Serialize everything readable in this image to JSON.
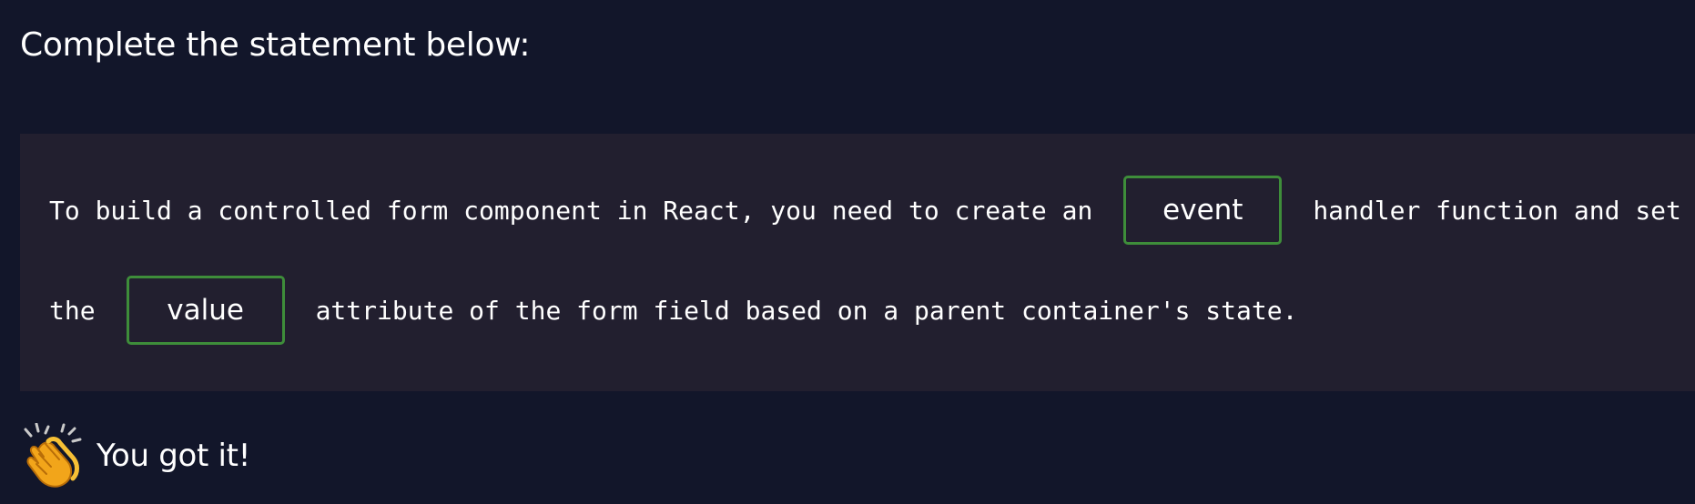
{
  "prompt": {
    "heading": "Complete the statement below:"
  },
  "statement": {
    "line1_before": "To build a controlled form component in React, you need to create an",
    "blank1_answer": "event",
    "line1_after": "handler function and set",
    "line2_before": "the",
    "blank2_answer": "value",
    "line2_after": "attribute of the form field based on a parent container's state."
  },
  "feedback": {
    "icon": "clapping-hands-icon",
    "message": "You got it!"
  },
  "colors": {
    "background": "#12162a",
    "code_background": "#221f2f",
    "blank_border": "#3e8d3a",
    "text": "#ffffff"
  }
}
